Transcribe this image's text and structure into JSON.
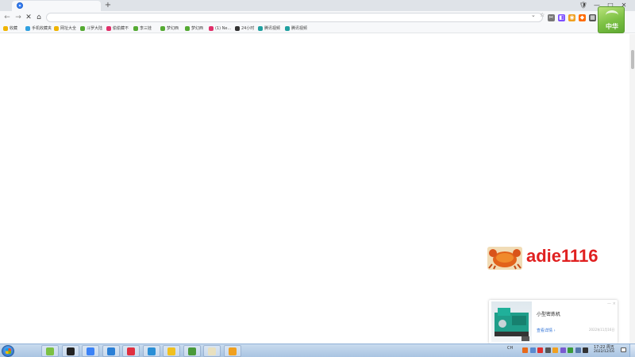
{
  "browser": {
    "new_tab_symbol": "+",
    "window_buttons": [
      "🛡",
      "—",
      "□",
      "✕"
    ],
    "nav_buttons": [
      "←",
      "→",
      "✕",
      "⌂"
    ],
    "address_value": "",
    "address_icons": [
      "⌄",
      "☆"
    ],
    "extensions": [
      {
        "name": "scissors-icon",
        "color": "#777777",
        "glyph": "✂"
      },
      {
        "name": "ext-purple-icon",
        "color": "#7c4dff",
        "glyph": "◧"
      },
      {
        "name": "ext-orange-icon",
        "color": "#f0a020",
        "glyph": "◉"
      },
      {
        "name": "gamepad-icon",
        "color": "#ff6a00",
        "glyph": "◆"
      },
      {
        "name": "grid-icon",
        "color": "#555555",
        "glyph": "▦"
      }
    ]
  },
  "bookmarks": [
    {
      "label": "收藏",
      "icon": "star-icon",
      "color": "#f0b400"
    },
    {
      "label": "手机收藏夹",
      "icon": "phone-icon",
      "color": "#30a0e0"
    },
    {
      "label": "网址大全",
      "icon": "globe-icon",
      "color": "#f0b400"
    },
    {
      "label": "斗罗大陆",
      "icon": "leaf-icon",
      "color": "#55aa33"
    },
    {
      "label": "偷偷藏不",
      "icon": "page-icon",
      "color": "#e0306a"
    },
    {
      "label": "李三娃",
      "icon": "leaf-icon",
      "color": "#55aa33"
    },
    {
      "label": "梦幻西",
      "icon": "leaf-icon",
      "color": "#55aa33"
    },
    {
      "label": "梦幻西",
      "icon": "leaf-icon",
      "color": "#55aa33"
    },
    {
      "label": "(1) Ne...",
      "icon": "page-icon",
      "color": "#e0306a"
    },
    {
      "label": "24小时",
      "icon": "m-icon",
      "color": "#333333"
    },
    {
      "label": "腾讯视频",
      "icon": "video-icon",
      "color": "#20a0a0"
    },
    {
      "label": "腾讯视频",
      "icon": "video-icon",
      "color": "#20a0a0"
    }
  ],
  "avatar": {
    "text": "中华"
  },
  "watermark": {
    "text": "adie1116"
  },
  "ad": {
    "title": "小型密炼机",
    "link_label": "查看详情 ›",
    "meta": "2022年11月16日",
    "close": "— ×"
  },
  "taskbar": {
    "apps": [
      {
        "name": "taskbar-app-1",
        "color": "#7bc043"
      },
      {
        "name": "taskbar-app-2",
        "color": "#222222"
      },
      {
        "name": "taskbar-app-3",
        "color": "#3b82f6"
      },
      {
        "name": "taskbar-app-4",
        "color": "#2a7fd6"
      },
      {
        "name": "taskbar-app-5",
        "color": "#e03040"
      },
      {
        "name": "taskbar-app-6",
        "color": "#2a8fd6"
      },
      {
        "name": "taskbar-app-7",
        "color": "#f0c020"
      },
      {
        "name": "taskbar-app-8",
        "color": "#4a9a3a"
      },
      {
        "name": "taskbar-app-9",
        "color": "#e8e0c0"
      },
      {
        "name": "taskbar-app-10",
        "color": "#f0a020"
      }
    ],
    "ime": "CH",
    "clock_time": "17:22 周五",
    "clock_date": "2022/12/16"
  }
}
